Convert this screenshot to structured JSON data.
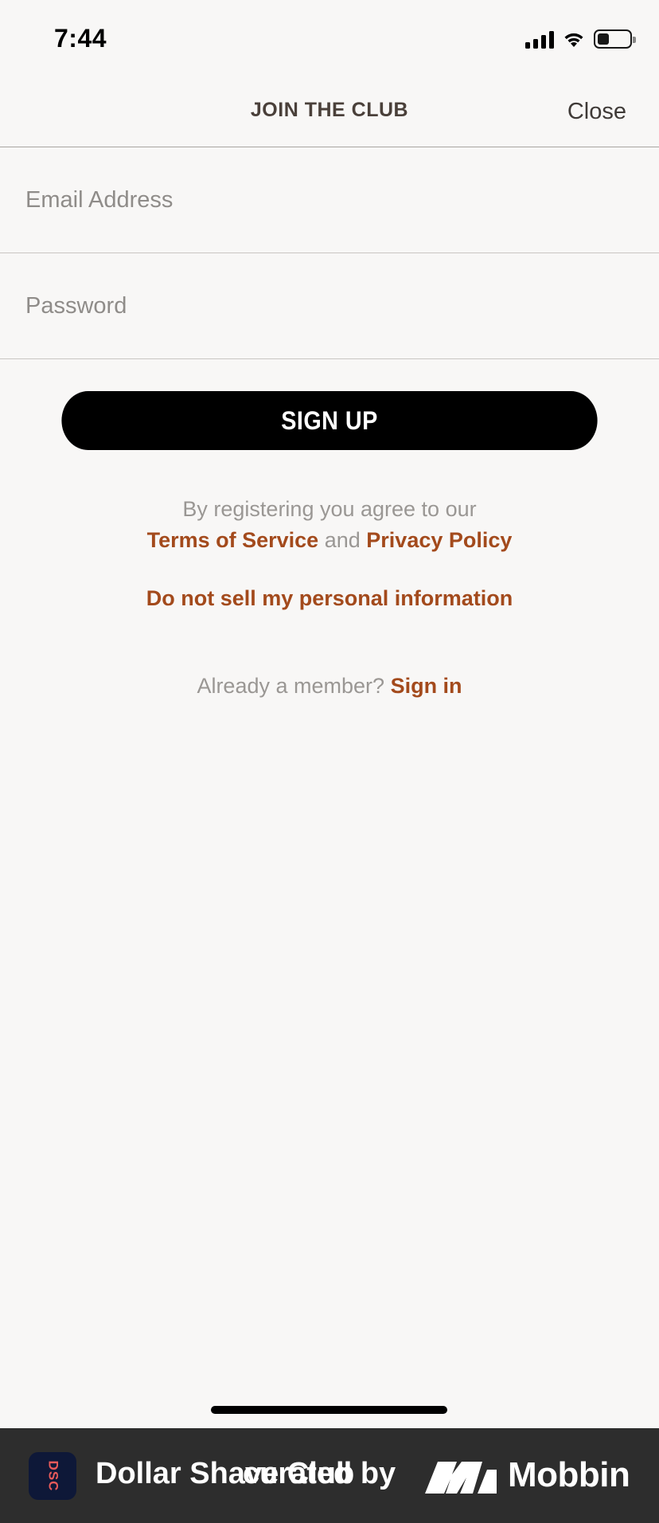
{
  "status_bar": {
    "time": "7:44"
  },
  "header": {
    "title": "JOIN THE CLUB",
    "close_label": "Close"
  },
  "form": {
    "email_placeholder": "Email Address",
    "email_value": "",
    "password_placeholder": "Password",
    "password_value": "",
    "submit_label": "SIGN UP"
  },
  "legal": {
    "prefix": "By registering you agree to our",
    "terms_label": "Terms of Service",
    "joiner": "and",
    "privacy_label": "Privacy Policy",
    "do_not_sell_label": "Do not sell my personal information"
  },
  "signin": {
    "prompt": "Already a member?",
    "link_label": "Sign in"
  },
  "banner": {
    "app_icon_text": "DSC",
    "app_name": "Dollar Shave Club",
    "curated_text": "curated by",
    "brand": "Mobbin"
  },
  "colors": {
    "accent": "#a34a1c",
    "button": "#000000",
    "background": "#f8f7f6",
    "banner": "#2d2d2d"
  }
}
